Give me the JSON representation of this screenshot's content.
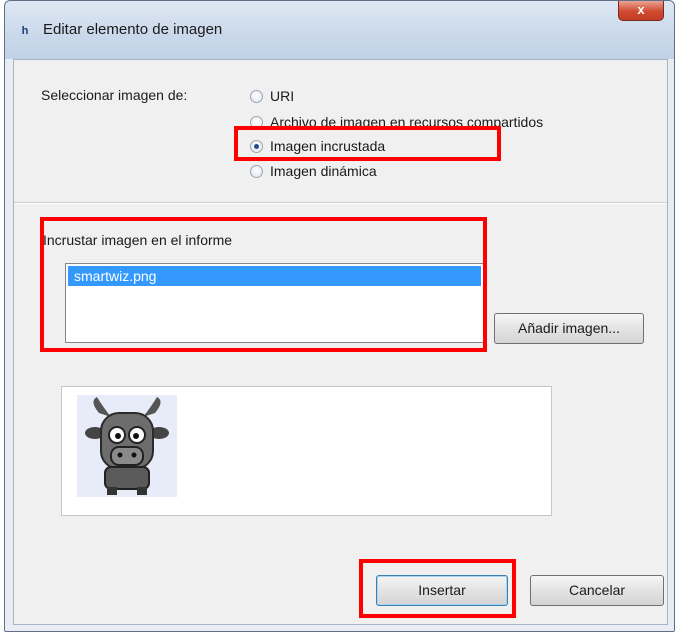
{
  "window": {
    "title": "Editar elemento de imagen",
    "close_glyph": "x",
    "app_icon_glyph": "h"
  },
  "source": {
    "label": "Seleccionar imagen de:",
    "options": [
      {
        "label": "URI",
        "selected": false
      },
      {
        "label": "Archivo de imagen en recursos compartidos",
        "selected": false
      },
      {
        "label": "Imagen incrustada",
        "selected": true
      },
      {
        "label": "Imagen dinámica",
        "selected": false
      }
    ]
  },
  "embed": {
    "label": "Incrustar imagen en el informe",
    "items": [
      "smartwiz.png"
    ],
    "selected_item": "smartwiz.png",
    "add_button": "Añadir imagen..."
  },
  "preview": {
    "image_icon": "goat-mascot-icon"
  },
  "footer": {
    "insert_button": "Insertar",
    "cancel_button": "Cancelar"
  },
  "colors": {
    "highlight": "#ff0000",
    "selection": "#3399ff",
    "titlebar": "#c9d8ea",
    "dialog_bg": "#f0f0f0"
  }
}
